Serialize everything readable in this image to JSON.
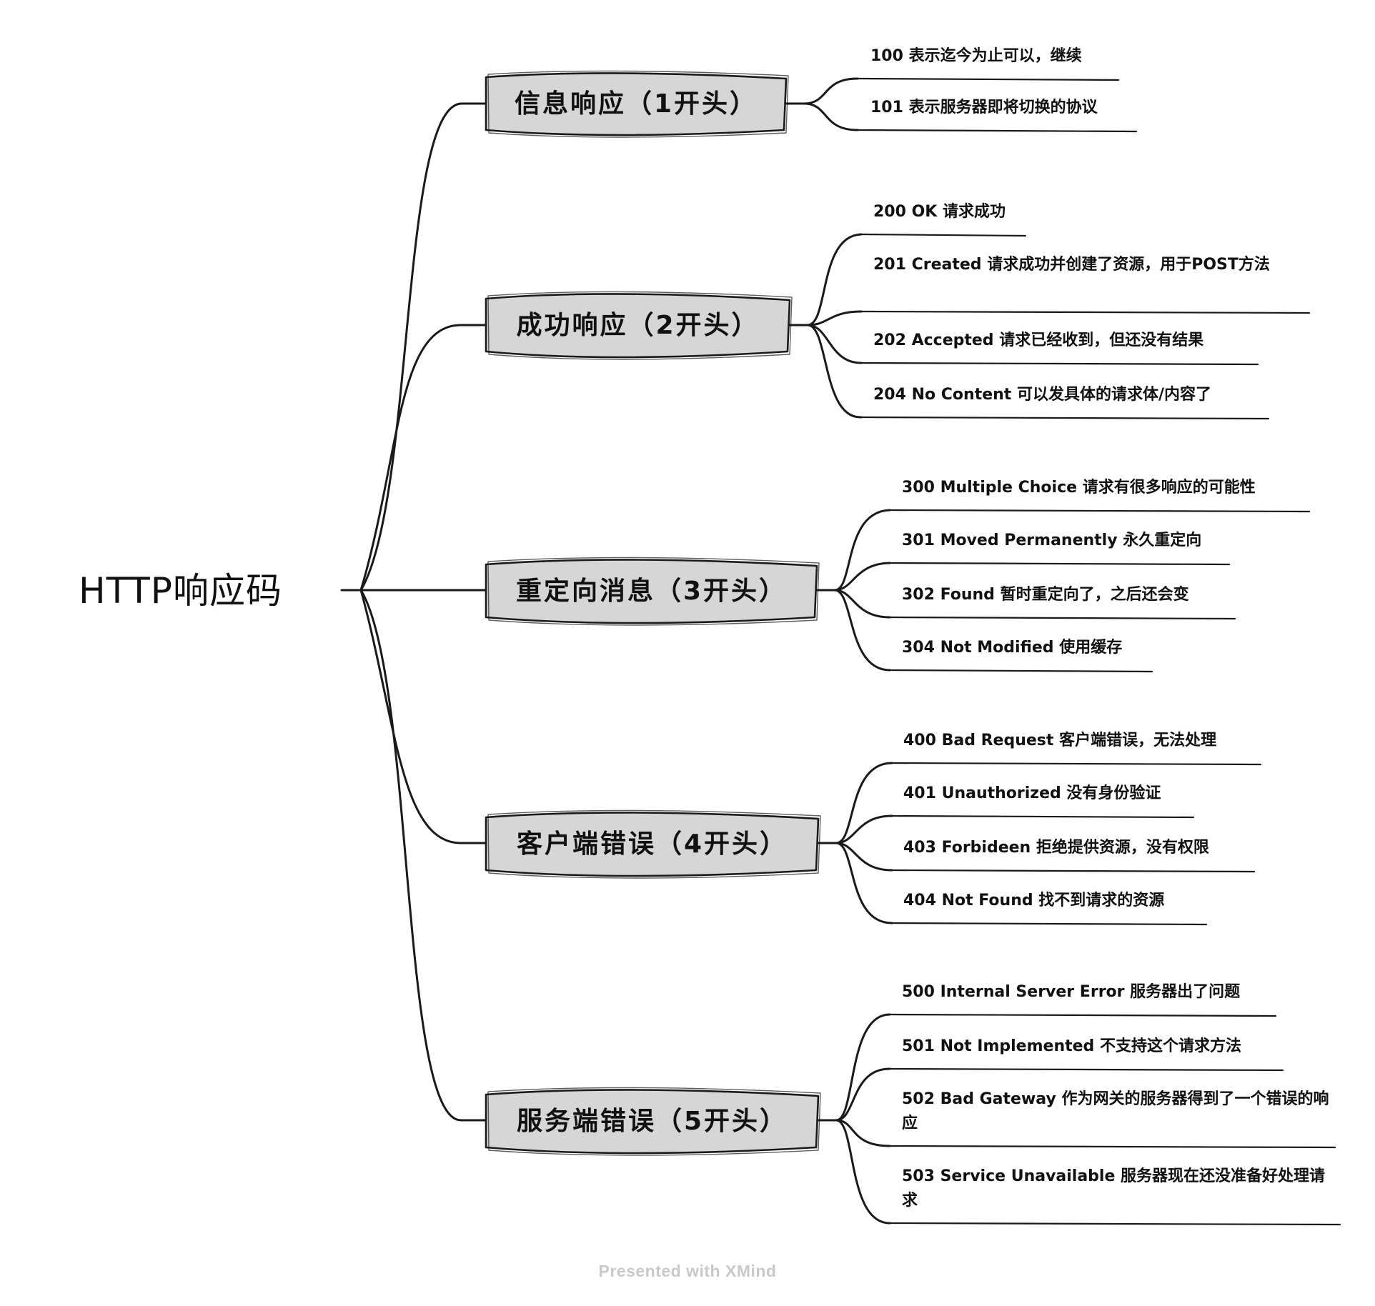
{
  "root": {
    "label": "HTTP响应码"
  },
  "categories": [
    {
      "label": "信息响应（1开头）",
      "items": [
        "100 表示迄今为止可以，继续",
        "101 表示服务器即将切换的协议"
      ]
    },
    {
      "label": "成功响应（2开头）",
      "items": [
        "200 OK 请求成功",
        "201 Created 请求成功并创建了资源，用于POST方法",
        "202 Accepted 请求已经收到，但还没有结果",
        "204 No Content 可以发具体的请求体/内容了"
      ]
    },
    {
      "label": "重定向消息（3开头）",
      "items": [
        "300 Multiple Choice 请求有很多响应的可能性",
        "301 Moved Permanently 永久重定向",
        "302 Found 暂时重定向了，之后还会变",
        "304 Not Modified 使用缓存"
      ]
    },
    {
      "label": "客户端错误（4开头）",
      "items": [
        "400 Bad Request 客户端错误，无法处理",
        "401 Unauthorized 没有身份验证",
        "403 Forbideen 拒绝提供资源，没有权限",
        "404 Not Found 找不到请求的资源"
      ]
    },
    {
      "label": "服务端错误（5开头）",
      "items": [
        "500 Internal Server Error 服务器出了问题",
        "501 Not Implemented 不支持这个请求方法",
        "502 Bad Gateway 作为网关的服务器得到了一个错误的响应",
        "503 Service Unavailable 服务器现在还没准备好处理请求"
      ]
    }
  ],
  "footer": "Presented with XMind"
}
